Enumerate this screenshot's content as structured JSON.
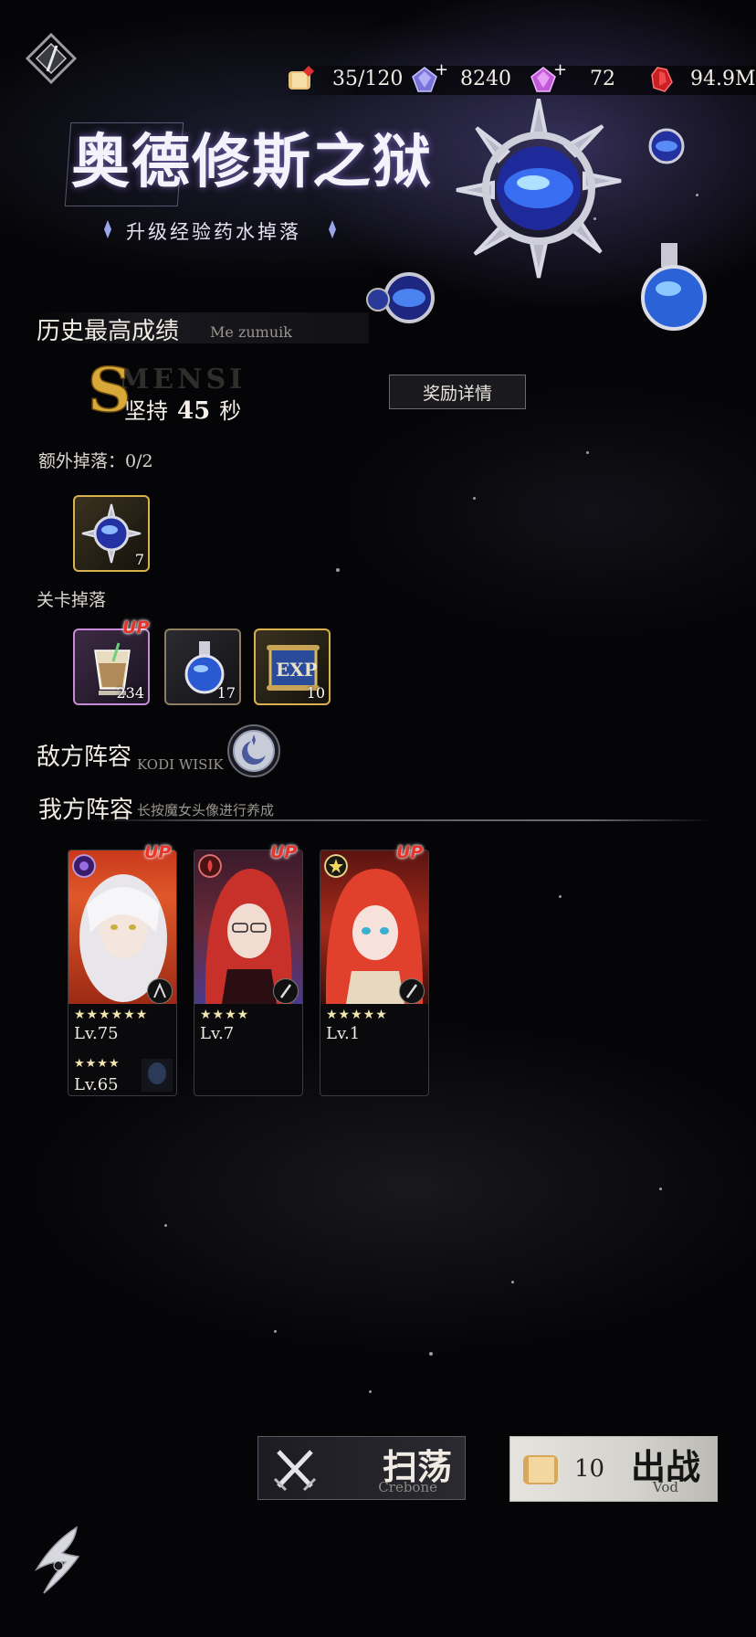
{
  "currency": {
    "stamina": "35/120",
    "crystal": "8240",
    "pink_gem": "72",
    "red_crystal": "94.9M"
  },
  "title": {
    "main": "奥德修斯之狱",
    "subtitle": "升级经验药水掉落"
  },
  "record": {
    "heading": "历史最高成绩",
    "heading_sub": "Me zumuik",
    "rank_ghost": "MENSI",
    "rank_letter": "S",
    "persist_prefix": "坚持",
    "persist_value": "45",
    "persist_unit": "秒",
    "reward_button": "奖励详情"
  },
  "extra_drop": {
    "label": "额外掉落：0/2",
    "items": [
      {
        "name": "exp-potion-large",
        "count": "7"
      }
    ]
  },
  "stage_drop": {
    "label": "关卡掉落",
    "items": [
      {
        "name": "drink-cup",
        "count": "234",
        "up": "UP"
      },
      {
        "name": "exp-potion",
        "count": "17"
      },
      {
        "name": "exp-scroll",
        "count": "10",
        "scroll_text": "EXP"
      }
    ]
  },
  "enemy": {
    "heading": "敌方阵容",
    "sub": "KODI WISIK"
  },
  "ally": {
    "heading": "我方阵容",
    "hint": "长按魔女头像进行养成"
  },
  "heroes": [
    {
      "up": "UP",
      "stars": "★★★★★★",
      "level": "Lv.75",
      "support_stars": "★★★★",
      "support_level": "Lv.65"
    },
    {
      "up": "UP",
      "stars": "★★★★",
      "level": "Lv.7"
    },
    {
      "up": "UP",
      "stars": "★★★★★",
      "level": "Lv.1"
    }
  ],
  "buttons": {
    "sweep_label": "扫荡",
    "sweep_sub": "Crebone",
    "battle_cost": "10",
    "battle_label": "出战",
    "battle_sub": "Vod"
  },
  "colors": {
    "gold_frame": "#d9b24e",
    "up_red": "#e8332a",
    "background": "#050507"
  }
}
